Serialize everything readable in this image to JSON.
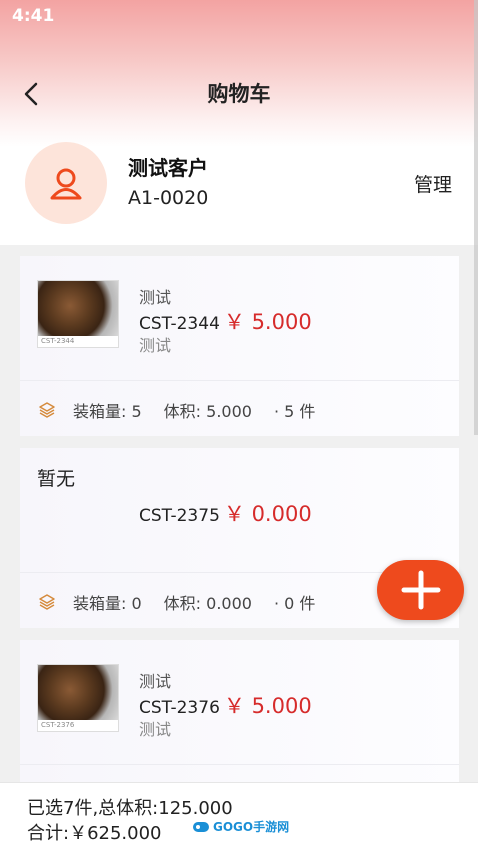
{
  "status": {
    "time": "4:41"
  },
  "header": {
    "title": "购物车"
  },
  "customer": {
    "name": "测试客户",
    "code": "A1-0020",
    "manage_label": "管理"
  },
  "items": [
    {
      "thumb_caption": "CST-2344",
      "name": "测试",
      "code": "CST-2344",
      "price": "￥ 5.000",
      "spec": "测试",
      "pack": "装箱量: 5",
      "volume": "体积: 5.000",
      "count": "· 5 件"
    },
    {
      "none_label": "暂无",
      "code": "CST-2375",
      "price": "￥ 0.000",
      "pack": "装箱量: 0",
      "volume": "体积: 0.000",
      "count": "· 0 件"
    },
    {
      "thumb_caption": "CST-2376",
      "name": "测试",
      "code": "CST-2376",
      "price": "￥ 5.000",
      "spec": "测试"
    }
  ],
  "footer": {
    "summary_selected": "已选7件,总体积:125.000",
    "summary_total": "合计:￥625.000"
  },
  "watermark": {
    "text": "GOGO手游网"
  },
  "colors": {
    "accent": "#ee4a1d",
    "price": "#d62b2b",
    "header_gradient": "#f3a3a2"
  }
}
